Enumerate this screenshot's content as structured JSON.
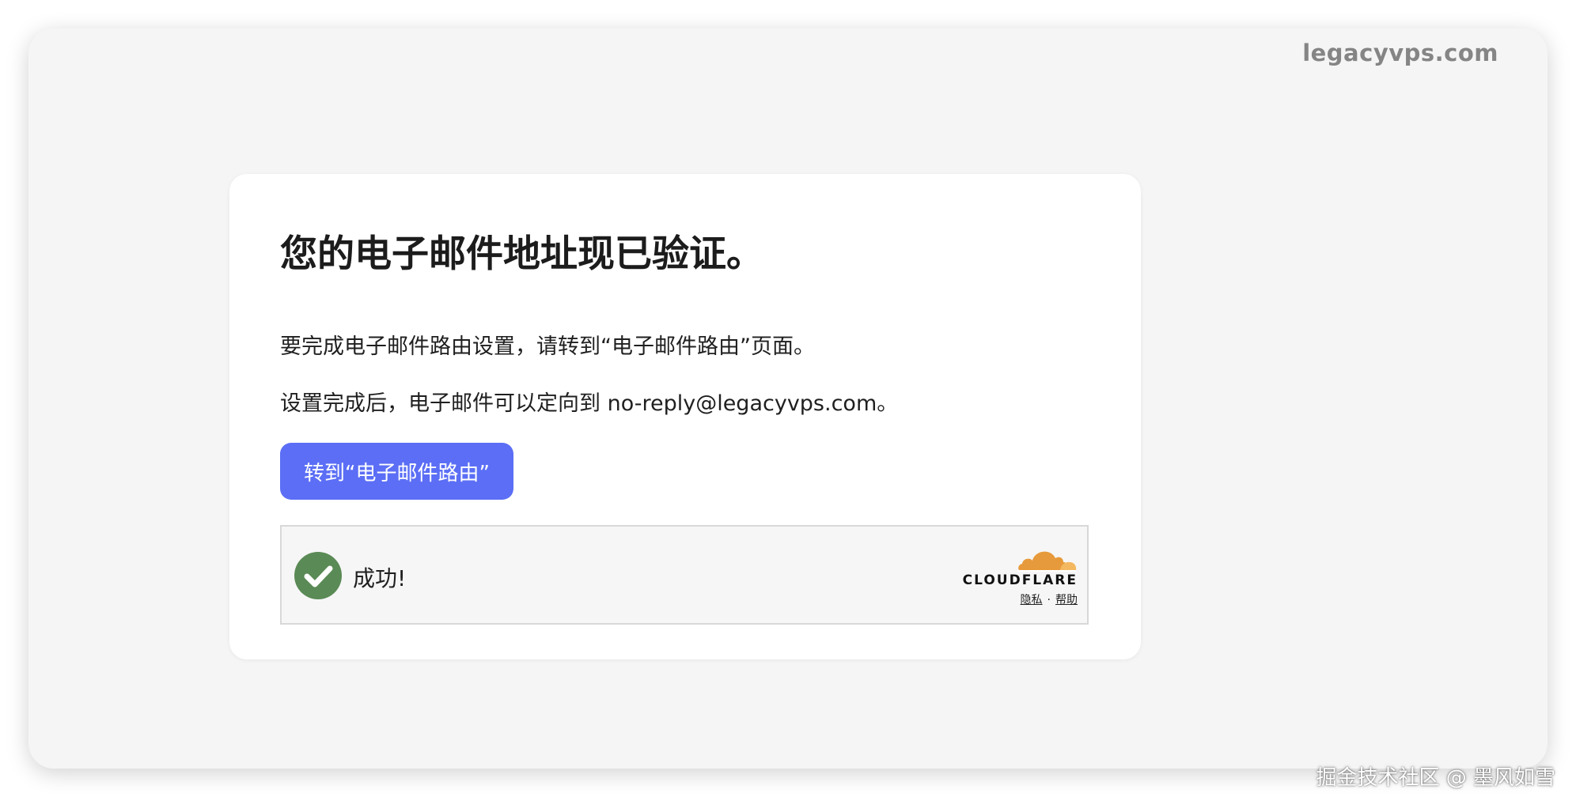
{
  "header": {
    "domain": "legacyvps.com"
  },
  "card": {
    "title": "您的电子邮件地址现已验证。",
    "line1": "要完成电子邮件路由设置，请转到“电子邮件路由”页面。",
    "line2": "设置完成后，电子邮件可以定向到 no-reply@legacyvps.com。",
    "button_label": "转到“电子邮件路由”"
  },
  "turnstile": {
    "status_text": "成功!",
    "brand": "CLOUDFLARE",
    "privacy_link": "隐私",
    "separator": "·",
    "help_link": "帮助"
  },
  "watermark": "掘金技术社区 @ 墨风如雪",
  "colors": {
    "button": "#5b6ef5",
    "success_check": "#5a8a55",
    "cloudflare_orange": "#e79a3b",
    "cloudflare_light": "#f4b860",
    "window_bg": "#f5f5f5",
    "domain_text": "#858585"
  },
  "icons": {
    "status": "check-circle-icon",
    "brand": "cloudflare-cloud-icon"
  }
}
